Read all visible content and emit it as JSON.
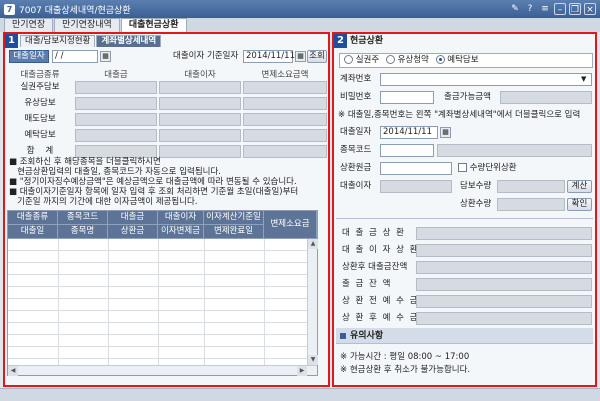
{
  "window": {
    "title": "7007 대출상세내역/현금상환",
    "icons": [
      "pin-icon",
      "help-icon",
      "menu-icon",
      "minimize-icon",
      "restore-icon",
      "close-icon"
    ]
  },
  "tabs": [
    "만기연장",
    "만기연장내역",
    "대출현금상환"
  ],
  "left": {
    "badge": "1",
    "subtabs": [
      "대출/담보지정현황",
      "계좌별상세내역"
    ],
    "loan_date_btn": "대출일자",
    "loan_date_value": " / /",
    "interest_base_label": "대출이자 기준일자",
    "interest_base_value": "2014/11/11",
    "query_btn": "조회",
    "col_headers": [
      "대출금종류",
      "대출금",
      "대출이자",
      "변제소요금액"
    ],
    "rows": [
      "실권주담보",
      "유상담보",
      "매도담보",
      "예탁담보",
      "합    계"
    ],
    "notes": [
      "■ 조회하신 후 해당종목을 더블클릭하시면",
      "   현금상환입력의 대출일, 종목코드가 자동으로 입력됩니다.",
      "■ \"정기이자징수예상금액\"은 예상금액으로 대출금액에 따라 변동될 수 있습니다.",
      "■ 대출이자기준일자 항목에 일자 입력 후 조회 처리하면 기준월 초일(대출일)부터",
      "   기준일 까지의 기간에 대한 이자금액이 제공됩니다."
    ],
    "grid_headers_top": [
      "대출종류",
      "종목코드",
      "대출금",
      "대출이자",
      "이자계산기준일"
    ],
    "grid_headers_bottom": [
      "대출일",
      "종목명",
      "상환금",
      "이자변제금",
      "변제완료일"
    ],
    "grid_header_tall": "변제소요금"
  },
  "right": {
    "badge": "2",
    "title": "현금상환",
    "radios": [
      "실권주",
      "유상청약",
      "예탁담보"
    ],
    "selected_radio": 2,
    "account_label": "계좌번호",
    "password_label": "비밀번호",
    "available_label": "출금가능금액",
    "instruction": "※ 대출일,종목번호는 왼쪽 \"계좌별상세내역\"에서 더블클릭으로 입력",
    "loan_date_label": "대출일자",
    "loan_date_value": "2014/11/11",
    "stock_code_label": "종목코드",
    "repay_label": "상환원금",
    "qty_unit_label": "수량단위상환",
    "interest_label": "대출이자",
    "collateral_qty_label": "담보수량",
    "calc_btn": "계산",
    "repay_qty_label": "상환수량",
    "confirm_btn": "확인",
    "summary_labels": [
      "대 출 금 상 환",
      "대 출 이 자 상 환",
      "상환후 대출금잔액",
      "출 금 잔 액",
      "상 환 전 예 수 금",
      "상 환 후 예 수 금"
    ],
    "notice_title": "유의사항",
    "notices": [
      "※ 가능시간 : 평일 08:00 ~ 17:00",
      "※ 현금상환 후 취소가 불가능합니다."
    ]
  }
}
